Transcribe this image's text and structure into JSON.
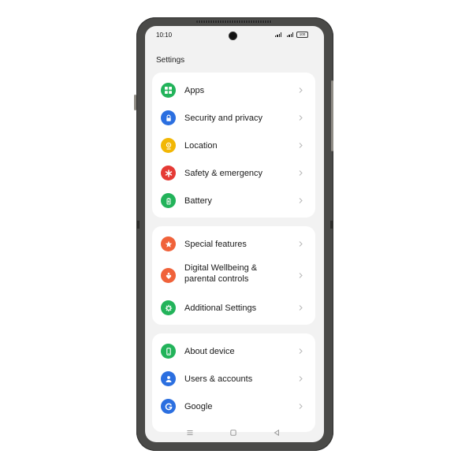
{
  "status_bar": {
    "time": "10:10",
    "battery": "100"
  },
  "page_title": "Settings",
  "groups": [
    {
      "items": [
        {
          "label": "Apps",
          "icon": "apps-grid-icon",
          "color": "#22b35a"
        },
        {
          "label": "Security and privacy",
          "icon": "lock-icon",
          "color": "#2b6fe0"
        },
        {
          "label": "Location",
          "icon": "location-pin-icon",
          "color": "#f2b705"
        },
        {
          "label": "Safety & emergency",
          "icon": "asterisk-icon",
          "color": "#e53a35"
        },
        {
          "label": "Battery",
          "icon": "battery-icon",
          "color": "#22b35a"
        }
      ]
    },
    {
      "items": [
        {
          "label": "Special features",
          "icon": "star-icon",
          "color": "#f0623a"
        },
        {
          "label": "Digital Wellbeing &",
          "label2": "parental controls",
          "icon": "heart-person-icon",
          "color": "#f0623a"
        },
        {
          "label": "Additional Settings",
          "icon": "gear-icon",
          "color": "#22b35a"
        }
      ]
    },
    {
      "items": [
        {
          "label": "About device",
          "icon": "phone-icon",
          "color": "#22b35a"
        },
        {
          "label": "Users & accounts",
          "icon": "person-icon",
          "color": "#2b6fe0"
        },
        {
          "label": "Google",
          "icon": "google-icon",
          "color": "#2b6fe0"
        }
      ]
    }
  ],
  "nav_bar": {
    "icons": [
      "menu-icon",
      "home-icon",
      "back-icon"
    ]
  }
}
